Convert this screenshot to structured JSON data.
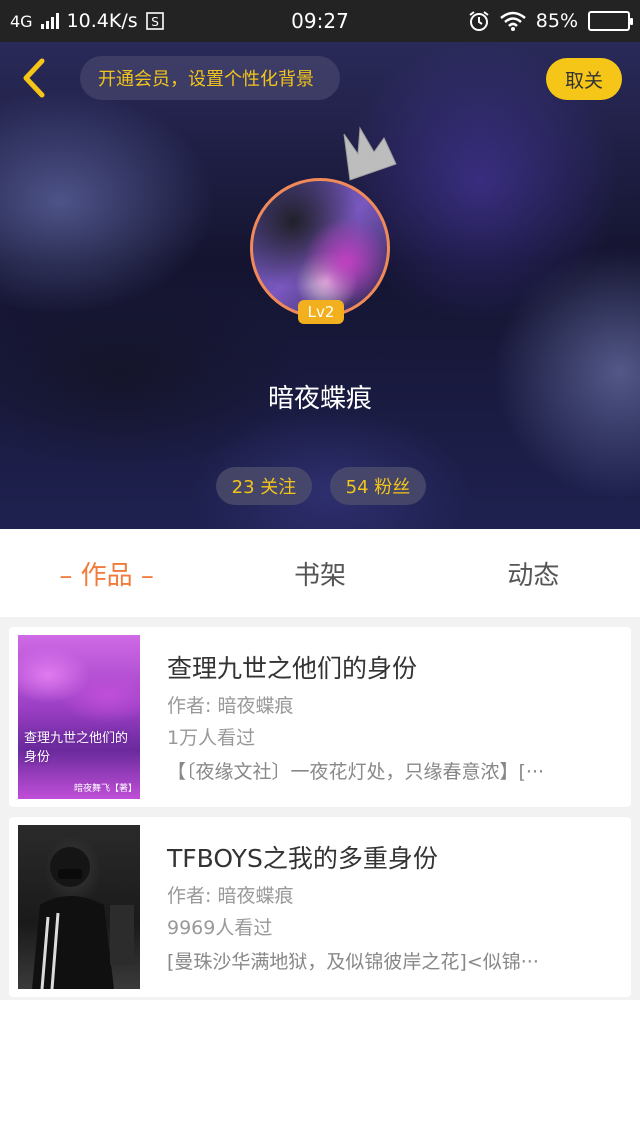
{
  "status_bar": {
    "network": "4G",
    "speed": "10.4K/s",
    "time": "09:27",
    "battery": "85%",
    "battery_level": 0.85
  },
  "header": {
    "member_prompt": "开通会员，设置个性化背景",
    "cancel_label": "取关"
  },
  "profile": {
    "level": "Lv2",
    "username": "暗夜蝶痕",
    "following": "23 关注",
    "fans": "54 粉丝"
  },
  "tabs": [
    {
      "label": "– 作品 –",
      "active": true
    },
    {
      "label": "书架",
      "active": false
    },
    {
      "label": "动态",
      "active": false
    }
  ],
  "works": [
    {
      "title": "查理九世之他们的身份",
      "author": "作者: 暗夜蝶痕",
      "views": "1万人看过",
      "desc": "【〔夜缘文社〕一夜花灯处，只缘春意浓】[···",
      "cover_title": "查理九世之他们的身份",
      "cover_author": "暗夜舞飞【著】"
    },
    {
      "title": "TFBOYS之我的多重身份",
      "author": "作者: 暗夜蝶痕",
      "views": "9969人看过",
      "desc": "[曼珠沙华满地狱，及似锦彼岸之花]<似锦···"
    }
  ],
  "colors": {
    "accent_orange": "#f07c3c",
    "brand_yellow": "#f5c518",
    "status_bar_bg": "#232323"
  }
}
